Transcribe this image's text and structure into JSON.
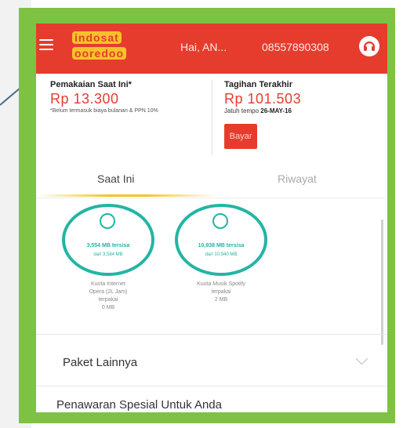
{
  "header": {
    "logo_line1": "indosat",
    "logo_line2": "ooredoo",
    "greeting": "Hai, AN...",
    "phone": "08557890308"
  },
  "usage": {
    "label": "Pemakaian Saat Ini*",
    "amount": "Rp 13.300",
    "note": "*Belum termasuk biaya bulanan & PPN 10%"
  },
  "bill": {
    "label": "Tagihan Terakhir",
    "amount": "Rp 101.503",
    "due_prefix": "Jatuh tempo",
    "due_date": "26-MAY-16",
    "pay_label": "Bayar"
  },
  "tabs": {
    "current": "Saat Ini",
    "history": "Riwayat"
  },
  "quotas": [
    {
      "remaining": "3,554 MB tersisa",
      "of": "dari 3,584 MB",
      "desc_lines": [
        "Kuota Internet",
        "Opera (2L Jam)",
        "terpakai",
        "0 MB"
      ]
    },
    {
      "remaining": "10,938 MB tersisa",
      "of": "dari 10,940 MB",
      "desc_lines": [
        "Kuota Musik Spotify",
        "terpakai",
        "2 MB"
      ]
    }
  ],
  "sections": {
    "other_packages": "Paket Lainnya",
    "special_offers": "Penawaran Spesial Untuk Anda"
  },
  "colors": {
    "brand_red": "#e63c2e",
    "brand_yellow": "#f6c22a",
    "quota_teal": "#23b5a4",
    "frame_green": "#7dc243"
  }
}
